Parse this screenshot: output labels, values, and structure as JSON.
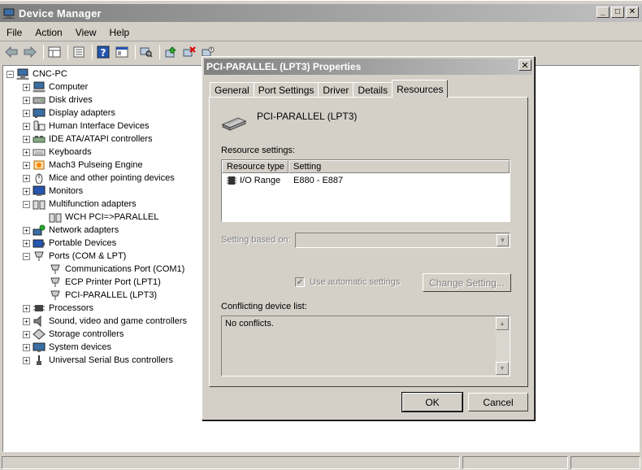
{
  "window": {
    "title": "Device Manager",
    "min_glyph": "_",
    "max_glyph": "□",
    "close_glyph": "✕"
  },
  "menu": [
    "File",
    "Action",
    "View",
    "Help"
  ],
  "toolbar_icons": [
    "back-icon",
    "forward-icon",
    "properties-grid-icon",
    "console-tree-icon",
    "help-icon",
    "view-icon",
    "scan-hardware-icon",
    "update-driver-icon",
    "uninstall-icon",
    "disable-icon"
  ],
  "tree": {
    "root": "CNC-PC",
    "expand_plus": "+",
    "expand_minus": "−",
    "items": [
      {
        "label": "Computer",
        "level": 1,
        "expander": "+",
        "icon": "computer-icon"
      },
      {
        "label": "Disk drives",
        "level": 1,
        "expander": "+",
        "icon": "disk-drive-icon"
      },
      {
        "label": "Display adapters",
        "level": 1,
        "expander": "+",
        "icon": "display-adapter-icon"
      },
      {
        "label": "Human Interface Devices",
        "level": 1,
        "expander": "+",
        "icon": "hid-icon"
      },
      {
        "label": "IDE ATA/ATAPI controllers",
        "level": 1,
        "expander": "+",
        "icon": "ide-controller-icon"
      },
      {
        "label": "Keyboards",
        "level": 1,
        "expander": "+",
        "icon": "keyboard-icon"
      },
      {
        "label": "Mach3 Pulseing Engine",
        "level": 1,
        "expander": "+",
        "icon": "mach3-icon"
      },
      {
        "label": "Mice and other pointing devices",
        "level": 1,
        "expander": "+",
        "icon": "mouse-icon"
      },
      {
        "label": "Monitors",
        "level": 1,
        "expander": "+",
        "icon": "monitor-icon"
      },
      {
        "label": "Multifunction adapters",
        "level": 1,
        "expander": "−",
        "icon": "multifunction-icon"
      },
      {
        "label": "WCH PCI=>PARALLEL",
        "level": 2,
        "expander": "",
        "icon": "multifunction-icon"
      },
      {
        "label": "Network adapters",
        "level": 1,
        "expander": "+",
        "icon": "network-adapter-icon"
      },
      {
        "label": "Portable Devices",
        "level": 1,
        "expander": "+",
        "icon": "portable-device-icon"
      },
      {
        "label": "Ports (COM & LPT)",
        "level": 1,
        "expander": "−",
        "icon": "port-icon"
      },
      {
        "label": "Communications Port (COM1)",
        "level": 2,
        "expander": "",
        "icon": "port-icon"
      },
      {
        "label": "ECP Printer Port (LPT1)",
        "level": 2,
        "expander": "",
        "icon": "port-icon"
      },
      {
        "label": "PCI-PARALLEL (LPT3)",
        "level": 2,
        "expander": "",
        "icon": "port-icon"
      },
      {
        "label": "Processors",
        "level": 1,
        "expander": "+",
        "icon": "processor-icon"
      },
      {
        "label": "Sound, video and game controllers",
        "level": 1,
        "expander": "+",
        "icon": "sound-icon"
      },
      {
        "label": "Storage controllers",
        "level": 1,
        "expander": "+",
        "icon": "storage-controller-icon"
      },
      {
        "label": "System devices",
        "level": 1,
        "expander": "+",
        "icon": "system-device-icon"
      },
      {
        "label": "Universal Serial Bus controllers",
        "level": 1,
        "expander": "+",
        "icon": "usb-icon"
      }
    ]
  },
  "dialog": {
    "title": "PCI-PARALLEL (LPT3) Properties",
    "close_glyph": "✕",
    "tabs": [
      "General",
      "Port Settings",
      "Driver",
      "Details",
      "Resources"
    ],
    "active_tab": "Resources",
    "device_name": "PCI-PARALLEL (LPT3)",
    "resource_settings_label": "Resource settings:",
    "columns": [
      "Resource type",
      "Setting"
    ],
    "resources": [
      {
        "type": "I/O Range",
        "setting": "E880 - E887"
      }
    ],
    "setting_based_on_label": "Setting based on:",
    "combo_arrow": "▼",
    "use_automatic_label": "Use automatic settings",
    "use_automatic_check": "✔",
    "change_setting_label": "Change Setting...",
    "conflicting_label": "Conflicting device list:",
    "conflicts_text": "No conflicts.",
    "scroll_up": "▲",
    "scroll_down": "▼",
    "ok_label": "OK",
    "cancel_label": "Cancel"
  },
  "colors": {
    "face": "#d4d0c8",
    "title_start": "#808080",
    "title_end": "#c0c0c0",
    "disabled_text": "#808080"
  }
}
